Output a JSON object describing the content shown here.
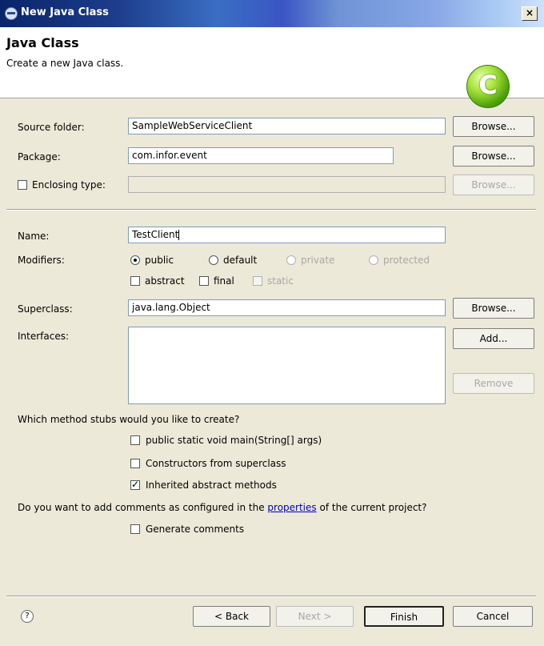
{
  "window": {
    "title": "New Java Class",
    "close_label": "×"
  },
  "header": {
    "title": "Java Class",
    "description": "Create a new Java class.",
    "logo_letter": "C"
  },
  "source_folder": {
    "label": "Source folder:",
    "value": "SampleWebServiceClient",
    "button": "Browse..."
  },
  "package": {
    "label": "Package:",
    "value": "com.infor.event",
    "button": "Browse..."
  },
  "enclosing_type": {
    "label": "Enclosing type:",
    "value": "",
    "button": "Browse...",
    "checked": false
  },
  "name": {
    "label": "Name:",
    "value": "TestClient"
  },
  "modifiers": {
    "label": "Modifiers:",
    "public": "public",
    "default": "default",
    "private": "private",
    "protected": "protected",
    "abstract": "abstract",
    "final": "final",
    "static": "static"
  },
  "superclass": {
    "label": "Superclass:",
    "value": "java.lang.Object",
    "button": "Browse..."
  },
  "interfaces": {
    "label": "Interfaces:",
    "add_button": "Add...",
    "remove_button": "Remove"
  },
  "stubs": {
    "question": "Which method stubs would you like to create?",
    "main": "public static void main(String[] args)",
    "constructors": "Constructors from superclass",
    "inherited": "Inherited abstract methods"
  },
  "comments": {
    "question_prefix": "Do you want to add comments as configured in the",
    "link": "properties",
    "question_suffix": "of the current project?",
    "generate": "Generate comments"
  },
  "footer": {
    "help": "?",
    "back": "< Back",
    "next": "Next >",
    "finish": "Finish",
    "cancel": "Cancel"
  }
}
